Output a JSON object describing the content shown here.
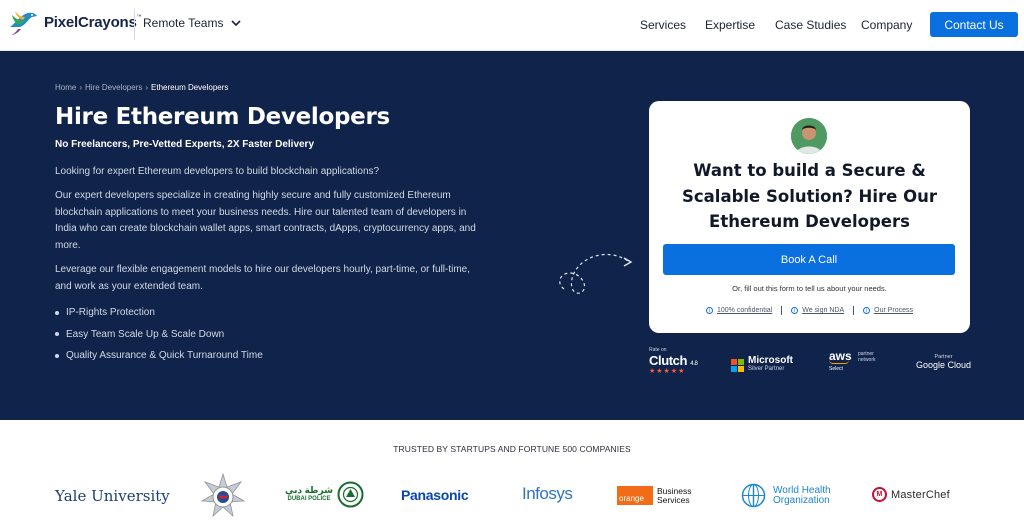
{
  "header": {
    "logo_text": "PixelCrayons",
    "logo_tm": "™",
    "team_select": "Remote Teams",
    "nav": [
      "Services",
      "Expertise",
      "Case Studies",
      "Company"
    ],
    "contact_label": "Contact Us",
    "accent_color": "#0a6fdf"
  },
  "breadcrumb": {
    "items": [
      "Home",
      "Hire Developers"
    ],
    "current": "Ethereum Developers",
    "separator": "›"
  },
  "hero": {
    "title": "Hire Ethereum Developers",
    "subtitle": "No Freelancers, Pre-Vetted Experts, 2X Faster Delivery",
    "p1": "Looking for expert Ethereum developers to build blockchain applications?",
    "p2": "Our expert developers specialize in creating highly secure and fully customized Ethereum blockchain applications to meet your business needs. Hire our talented team of developers in India who can create blockchain wallet apps, smart contracts, dApps, cryptocurrency apps, and more.",
    "p3": "Leverage our flexible engagement models to hire our developers hourly, part-time, or full-time, and work as your extended team.",
    "bullets": [
      "IP-Rights Protection",
      "Easy Team Scale Up & Scale Down",
      "Quality Assurance & Quick Turnaround Time"
    ],
    "background_color": "#10234a"
  },
  "cta": {
    "title": "Want to build a Secure & Scalable Solution? Hire Our Ethereum Developers",
    "button": "Book A Call",
    "note": "Or, fill out this form to tell us about your needs.",
    "badges": [
      "100% confidential",
      "We sign NDA",
      "Our Process"
    ]
  },
  "partners": {
    "clutch": {
      "rate_on": "Rate on",
      "name": "Clutch",
      "rating": "4.8",
      "stars": "★★★★★"
    },
    "microsoft": {
      "name": "Microsoft",
      "level": "Silver Partner"
    },
    "aws": {
      "name": "aws",
      "partner_network": "partner network",
      "select": "Select"
    },
    "google": {
      "partner": "Partner",
      "name": "Google Cloud"
    }
  },
  "trusted": {
    "title": "TRUSTED BY STARTUPS AND FORTUNE 500 COMPANIES",
    "yale": "Yale University",
    "dubai_police_ar": "شرطة دبي",
    "dubai_police": "DUBAI POLICE",
    "panasonic": "Panasonic",
    "infosys": "Infosys",
    "orange": "orange",
    "orange_bs": [
      "Business",
      "Services"
    ],
    "who": [
      "World Health",
      "Organization"
    ],
    "masterchef": "MasterChef"
  }
}
